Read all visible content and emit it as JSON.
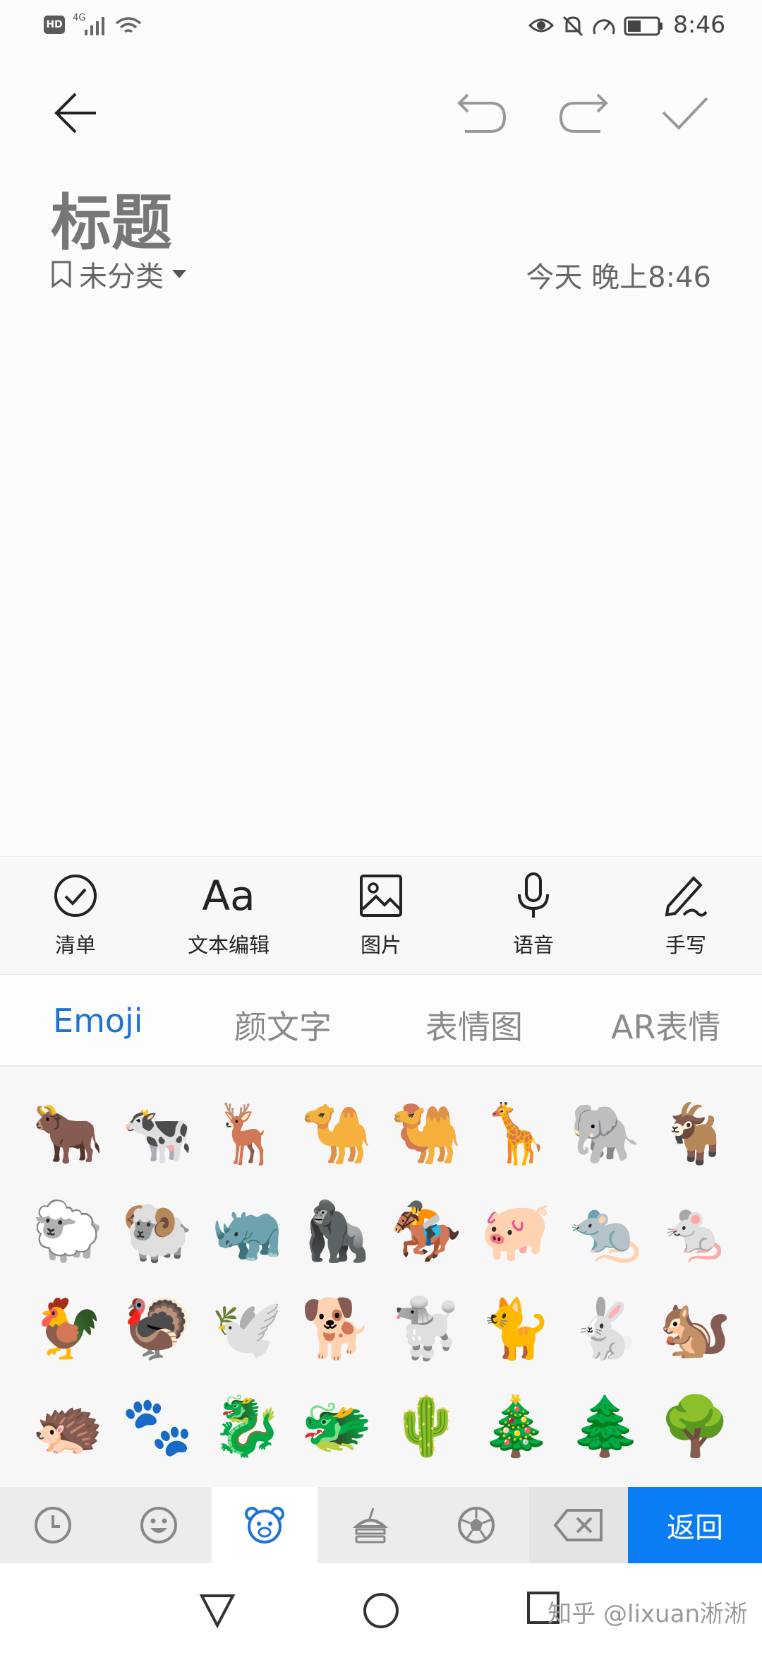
{
  "status_bar": {
    "hd_badge": "HD",
    "network": "4G",
    "time": "8:46",
    "icons": [
      "signal-icon",
      "wifi-icon",
      "eye-icon",
      "mute-bell-icon",
      "speed-icon",
      "battery-icon"
    ]
  },
  "toolbar": {
    "icons": [
      "back-arrow-icon",
      "undo-icon",
      "redo-icon",
      "confirm-check-icon"
    ]
  },
  "note": {
    "title_placeholder": "标题",
    "category": "未分类",
    "timestamp": "今天 晚上8:46"
  },
  "format_bar": {
    "items": [
      {
        "label": "清单",
        "icon": "checklist-icon"
      },
      {
        "label": "文本编辑",
        "icon": "text-format-icon",
        "glyph": "Aa"
      },
      {
        "label": "图片",
        "icon": "image-icon"
      },
      {
        "label": "语音",
        "icon": "microphone-icon"
      },
      {
        "label": "手写",
        "icon": "handwriting-pen-icon"
      }
    ]
  },
  "emoji_tabs": [
    {
      "label": "Emoji",
      "active": true
    },
    {
      "label": "颜文字",
      "active": false
    },
    {
      "label": "表情图",
      "active": false
    },
    {
      "label": "AR表情",
      "active": false
    }
  ],
  "emoji_grid": [
    [
      "🐂",
      "🐄",
      "🦌",
      "🐪",
      "🐫",
      "🦒",
      "🐘",
      "🐐"
    ],
    [
      "🐑",
      "🐏",
      "🦏",
      "🦍",
      "🏇",
      "🐖",
      "🐀",
      "🐁"
    ],
    [
      "🐓",
      "🦃",
      "🕊️",
      "🐕",
      "🐩",
      "🐈",
      "🐇",
      "🐿️"
    ],
    [
      "🦔",
      "🐾",
      "🐉",
      "🐲",
      "🌵",
      "🎄",
      "🌲",
      "🌳"
    ]
  ],
  "category_bar": {
    "icons": [
      "recent-clock-icon",
      "smiley-icon",
      "animal-bear-icon",
      "food-icon",
      "sports-ball-icon",
      "delete-backspace-icon"
    ],
    "active_index": 2,
    "return_label": "返回"
  },
  "watermark": "知乎 @lixuan淅淅",
  "colors": {
    "accent": "#1e73d2",
    "return_button": "#0a7cf4"
  }
}
